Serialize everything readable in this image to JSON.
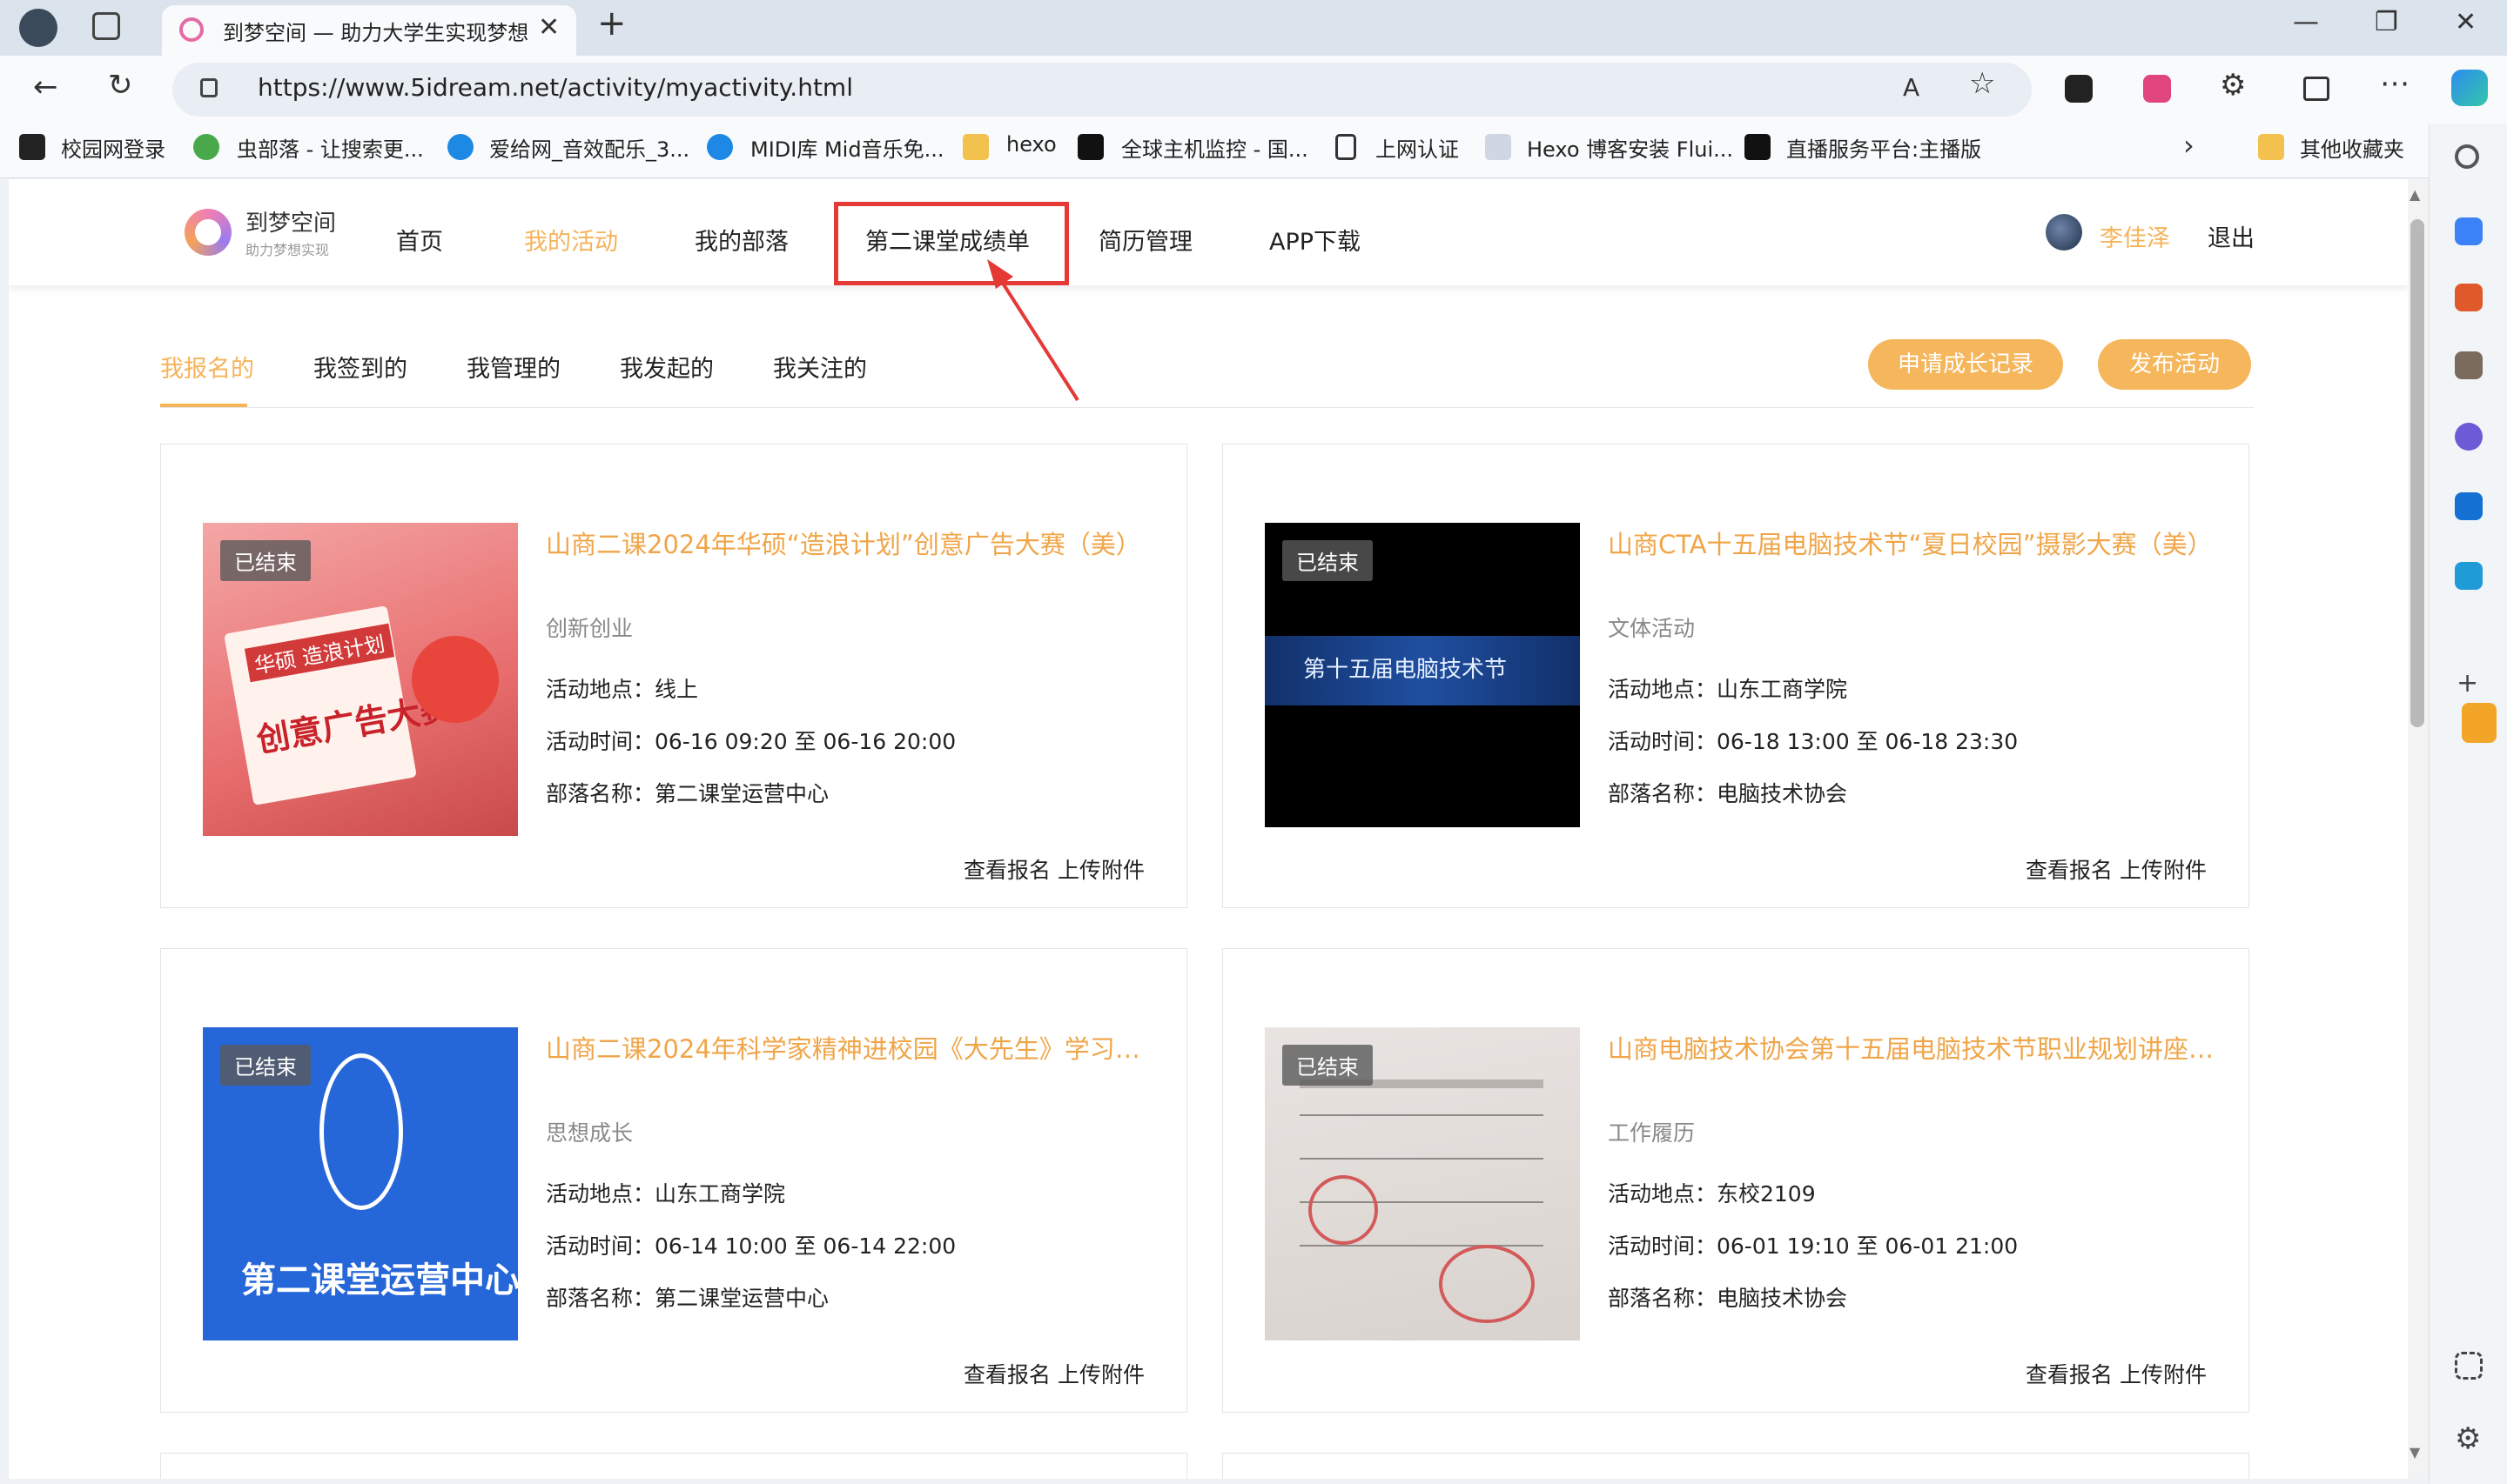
{
  "browser": {
    "tab_title": "到梦空间 — 助力大学生实现梦想",
    "tab_close": "✕",
    "new_tab": "+",
    "url": "https://www.5idream.net/activity/myactivity.html",
    "win_min": "—",
    "win_max": "❐",
    "win_close": "✕"
  },
  "bookmarks": [
    {
      "label": "校园网登录"
    },
    {
      "label": "虫部落 - 让搜索更..."
    },
    {
      "label": "爱给网_音效配乐_3..."
    },
    {
      "label": "MIDI库 Mid音乐免..."
    },
    {
      "label": "hexo"
    },
    {
      "label": "全球主机监控 - 国..."
    },
    {
      "label": "上网认证"
    },
    {
      "label": "Hexo 博客安装 Flui..."
    },
    {
      "label": "直播服务平台:主播版"
    },
    {
      "label": "其他收藏夹"
    }
  ],
  "site": {
    "logo_title": "到梦空间",
    "logo_sub": "助力梦想实现",
    "nav": [
      {
        "label": "首页"
      },
      {
        "label": "我的活动"
      },
      {
        "label": "我的部落"
      },
      {
        "label": "第二课堂成绩单"
      },
      {
        "label": "简历管理"
      },
      {
        "label": "APP下载"
      }
    ],
    "username": "李佳泽",
    "logout": "退出"
  },
  "subtabs": [
    {
      "label": "我报名的"
    },
    {
      "label": "我签到的"
    },
    {
      "label": "我管理的"
    },
    {
      "label": "我发起的"
    },
    {
      "label": "我关注的"
    }
  ],
  "buttons": {
    "growth": "申请成长记录",
    "publish": "发布活动"
  },
  "cards": [
    {
      "badge": "已结束",
      "title": "山商二课2024年华硕“造浪计划”创意广告大赛（美）",
      "category": "创新创业",
      "location": "活动地点：线上",
      "time": "活动时间：06-16 09:20 至 06-16 20:00",
      "org": "部落名称：第二课堂运营中心",
      "view": "查看报名",
      "upload": "上传附件",
      "img_text": "创意广告大赛",
      "img_tag": "华硕 造浪计划"
    },
    {
      "badge": "已结束",
      "title": "山商CTA十五届电脑技术节“夏日校园”摄影大赛（美）",
      "category": "文体活动",
      "location": "活动地点：山东工商学院",
      "time": "活动时间：06-18 13:00 至 06-18 23:30",
      "org": "部落名称：电脑技术协会",
      "view": "查看报名",
      "upload": "上传附件",
      "img_text": "第十五届电脑技术节"
    },
    {
      "badge": "已结束",
      "title": "山商二课2024年科学家精神进校园《大先生》学习活动...",
      "category": "思想成长",
      "location": "活动地点：山东工商学院",
      "time": "活动时间：06-14 10:00 至 06-14 22:00",
      "org": "部落名称：第二课堂运营中心",
      "view": "查看报名",
      "upload": "上传附件",
      "img_text": "第二课堂运营中心"
    },
    {
      "badge": "已结束",
      "title": "山商电脑技术协会第十五届电脑技术节职业规划讲座（...",
      "category": "工作履历",
      "location": "活动地点：东校2109",
      "time": "活动时间：06-01 19:10 至 06-01 21:00",
      "org": "部落名称：电脑技术协会",
      "view": "查看报名",
      "upload": "上传附件"
    }
  ],
  "colors": {
    "accent": "#f5b65c",
    "title_orange": "#f0a548",
    "annotation_red": "#e53935"
  }
}
